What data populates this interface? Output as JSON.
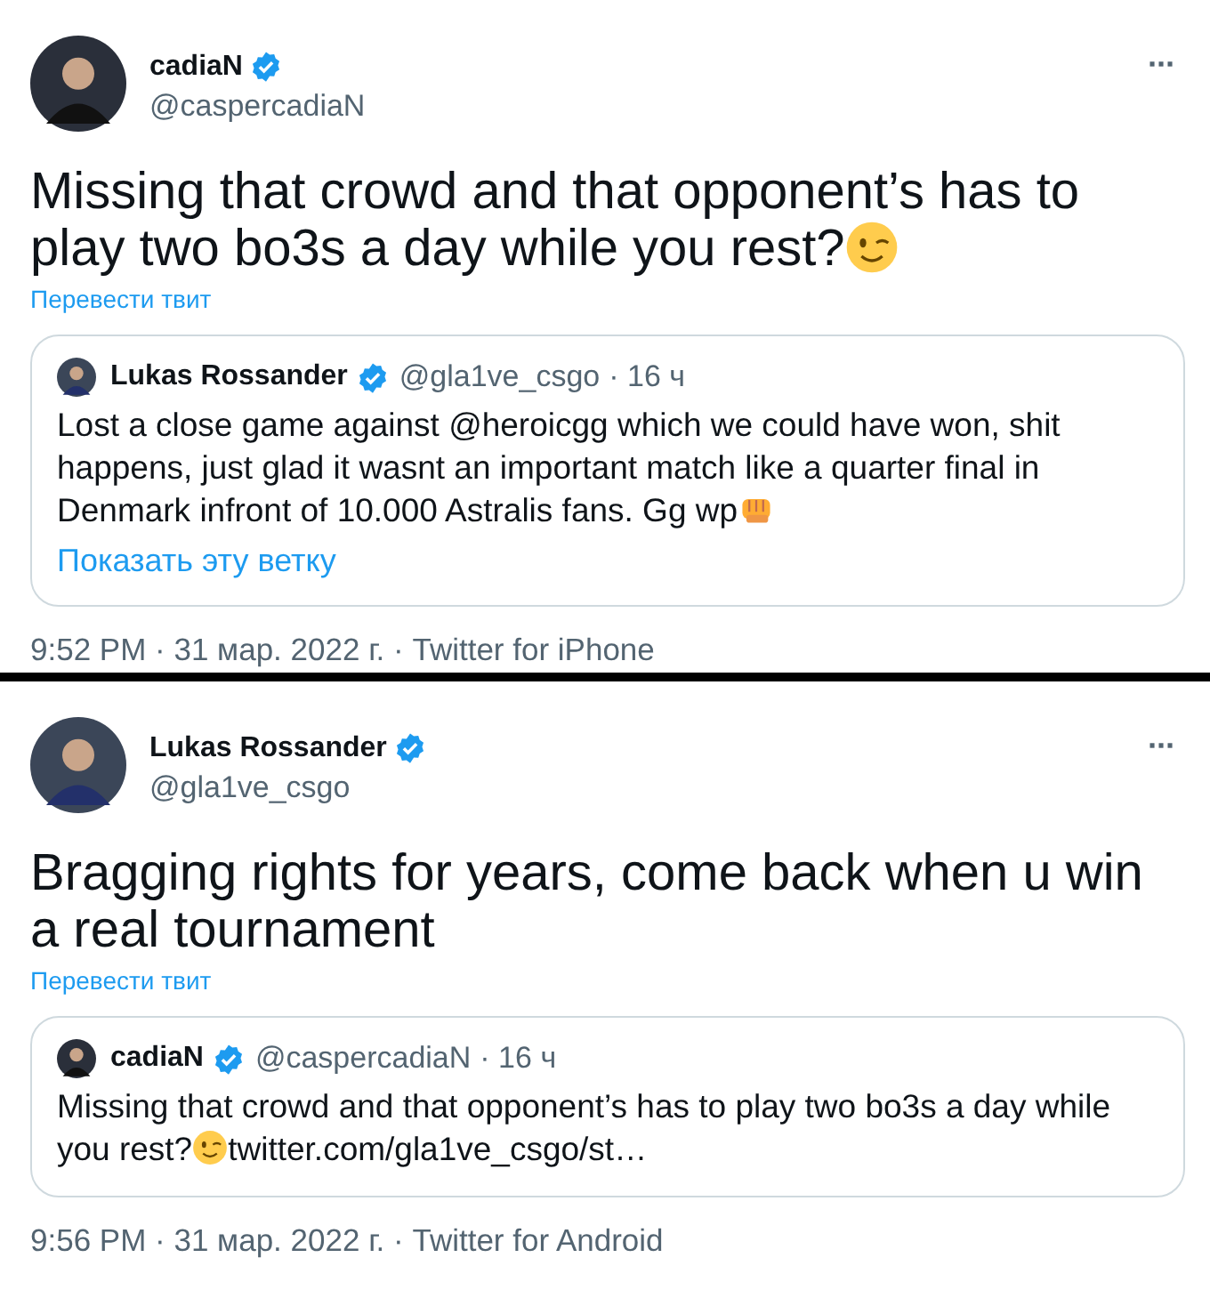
{
  "tweets": [
    {
      "author": {
        "name": "cadiaN",
        "verified": true,
        "handle": "@caspercadiaN"
      },
      "more": "···",
      "text": "Missing that crowd and that opponent’s has to play two bo3s a day while you rest?",
      "emoji": {
        "kind": "wink"
      },
      "translate": "Перевести твит",
      "quote": {
        "author": {
          "name": "Lukas Rossander",
          "verified": true,
          "handle": "@gla1ve_csgo",
          "time": "· 16 ч"
        },
        "text": "Lost a close game against @heroicgg which we could have won, shit happens, just glad it wasnt an important match like a quarter final in Denmark infront of 10.000 Astralis fans. Gg wp",
        "emoji": {
          "kind": "fist"
        },
        "thread_link": "Показать эту ветку"
      },
      "meta": "9:52 PM · 31 мар. 2022 г. · Twitter for iPhone"
    },
    {
      "author": {
        "name": "Lukas Rossander",
        "verified": true,
        "handle": "@gla1ve_csgo"
      },
      "more": "···",
      "text": "Bragging rights for years, come back when u win a real tournament",
      "translate": "Перевести твит",
      "quote": {
        "author": {
          "name": "cadiaN",
          "verified": true,
          "handle": "@caspercadiaN",
          "time": "· 16 ч"
        },
        "text": "Missing that crowd and that opponent’s has to play two bo3s a day while you rest?",
        "emoji": {
          "kind": "wink"
        },
        "tail": "twitter.com/gla1ve_csgo/st…"
      },
      "meta": "9:56 PM · 31 мар. 2022 г. · Twitter for Android"
    }
  ]
}
